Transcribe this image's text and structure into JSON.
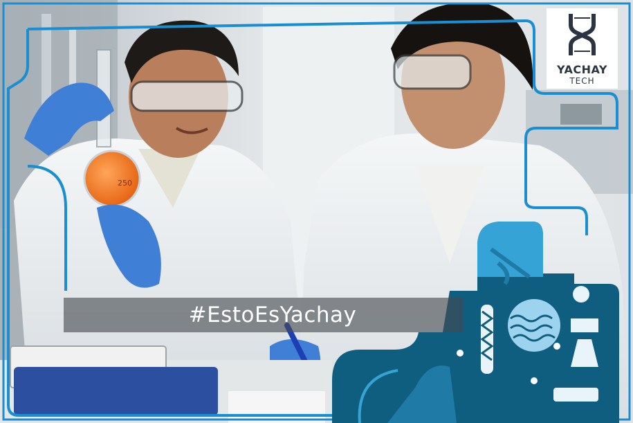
{
  "hashtag": "#EstoEsYachay",
  "logo": {
    "title": "YACHAY",
    "subtitle": "TECH",
    "icon": "dna-helix-icon"
  },
  "flask_label": "250",
  "colors": {
    "frame_blue": "#1a8ed0",
    "illustration_dark": "#0f5e80",
    "illustration_mid": "#1f7aa6",
    "illustration_light": "#35a3d6",
    "glove_blue": "#3f7fd6",
    "flask_orange": "#f07a28",
    "banner_gray": "#5a5f64"
  }
}
